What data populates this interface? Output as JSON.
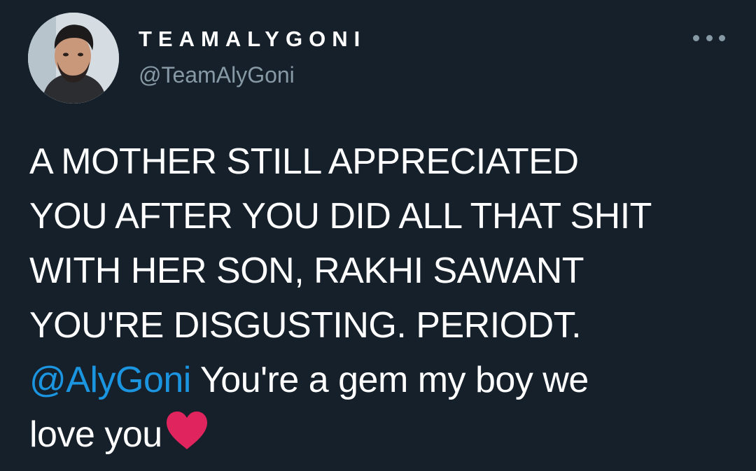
{
  "author": {
    "display_name": "TEAMALYGONI",
    "handle": "@TeamAlyGoni",
    "avatar_icon": "profile-photo"
  },
  "tweet": {
    "lines": [
      "A MOTHER STILL APPRECIATED",
      "YOU AFTER YOU DID ALL THAT SHIT",
      "WITH HER SON, RAKHI SAWANT",
      "YOU'RE DISGUSTING. PERIODT."
    ],
    "mention": "@AlyGoni",
    "after_mention": " You're a gem my boy we",
    "last_line": "love you",
    "emoji": "heart-icon"
  },
  "colors": {
    "background": "#15202b",
    "text": "#ffffff",
    "secondary": "#8899a6",
    "link": "#1b95e0",
    "heart": "#e0245e"
  },
  "more_icon": "more-horizontal-icon"
}
